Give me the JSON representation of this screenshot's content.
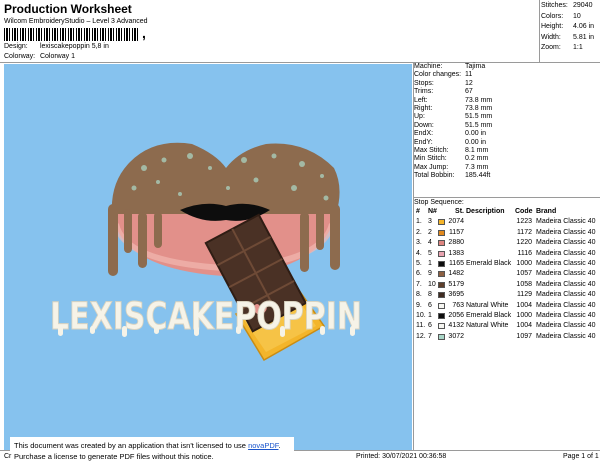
{
  "header": {
    "title": "Production Worksheet",
    "subtitle": "Wilcom EmbroideryStudio – Level 3 Advanced",
    "barcode_mark": ",",
    "design_label": "Design:",
    "design_value": "lexiscakepoppin 5,8 in",
    "colorway_label": "Colorway:",
    "colorway_value": "Colorway 1"
  },
  "stats": [
    {
      "label": "Stitches:",
      "value": "29040"
    },
    {
      "label": "Colors:",
      "value": "10"
    },
    {
      "label": "Height:",
      "value": "4.06 in"
    },
    {
      "label": "Width:",
      "value": "5.81 in"
    },
    {
      "label": "Zoom:",
      "value": "1:1"
    }
  ],
  "machine": [
    {
      "label": "Machine:",
      "value": "Tajima"
    },
    {
      "label": "Color changes:",
      "value": "11"
    },
    {
      "label": "Stops:",
      "value": "12"
    },
    {
      "label": "Trims:",
      "value": "67"
    },
    {
      "label": "Left:",
      "value": "73.8 mm"
    },
    {
      "label": "Right:",
      "value": "73.8 mm"
    },
    {
      "label": "Up:",
      "value": "51.5 mm"
    },
    {
      "label": "Down:",
      "value": "51.5 mm"
    },
    {
      "label": "EndX:",
      "value": "0.00 in"
    },
    {
      "label": "EndY:",
      "value": "0.00 in"
    },
    {
      "label": "Max Stitch:",
      "value": "8.1 mm"
    },
    {
      "label": "Min Stitch:",
      "value": "0.2 mm"
    },
    {
      "label": "Max Jump:",
      "value": "7.3 mm"
    },
    {
      "label": "Total Bobbin:",
      "value": "185.44ft"
    }
  ],
  "stop_sequence": {
    "caption": "Stop Sequence:",
    "headers": {
      "num": "#",
      "n": "N#",
      "st": "St.",
      "desc": "Description",
      "code": "Code",
      "brand": "Brand"
    },
    "rows": [
      {
        "num": "1.",
        "n": "3",
        "color": "#f5b52a",
        "st": "2074",
        "desc": "",
        "code": "1223",
        "brand": "Madeira Classic 40"
      },
      {
        "num": "2.",
        "n": "2",
        "color": "#e38a1e",
        "st": "1157",
        "desc": "",
        "code": "1172",
        "brand": "Madeira Classic 40"
      },
      {
        "num": "3.",
        "n": "4",
        "color": "#de8580",
        "st": "2880",
        "desc": "",
        "code": "1220",
        "brand": "Madeira Classic 40"
      },
      {
        "num": "4.",
        "n": "5",
        "color": "#e9a3b0",
        "st": "1383",
        "desc": "",
        "code": "1116",
        "brand": "Madeira Classic 40"
      },
      {
        "num": "5.",
        "n": "1",
        "color": "#0d0d0d",
        "st": "1165",
        "desc": "Emerald Black",
        "code": "1000",
        "brand": "Madeira Classic 40"
      },
      {
        "num": "6.",
        "n": "9",
        "color": "#8d6042",
        "st": "1482",
        "desc": "",
        "code": "1057",
        "brand": "Madeira Classic 40"
      },
      {
        "num": "7.",
        "n": "10",
        "color": "#5e3f2b",
        "st": "5179",
        "desc": "",
        "code": "1058",
        "brand": "Madeira Classic 40"
      },
      {
        "num": "8.",
        "n": "8",
        "color": "#3f2b21",
        "st": "3695",
        "desc": "",
        "code": "1129",
        "brand": "Madeira Classic 40"
      },
      {
        "num": "9.",
        "n": "6",
        "color": "#f6f6f2",
        "st": "763",
        "desc": "Natural White",
        "code": "1004",
        "brand": "Madeira Classic 40"
      },
      {
        "num": "10.",
        "n": "1",
        "color": "#0d0d0d",
        "st": "2056",
        "desc": "Emerald Black",
        "code": "1000",
        "brand": "Madeira Classic 40"
      },
      {
        "num": "11.",
        "n": "6",
        "color": "#f6f6f2",
        "st": "4132",
        "desc": "Natural White",
        "code": "1004",
        "brand": "Madeira Classic 40"
      },
      {
        "num": "12.",
        "n": "7",
        "color": "#a9d6c7",
        "st": "3072",
        "desc": "",
        "code": "1097",
        "brand": "Madeira Classic 40"
      }
    ]
  },
  "design": {
    "background": "#86c2ee",
    "text": "LEXISCAKEPOPPIN"
  },
  "notice": {
    "line1_prefix": "This document was created by an application that isn't licensed to use ",
    "link": "novaPDF",
    "line1_suffix": ".",
    "line2": "Purchase a license to generate PDF files without this notice."
  },
  "footer": {
    "cr": "Cr",
    "printed": "Printed: 30/07/2021 00:36:58",
    "page": "Page 1 of 1"
  }
}
